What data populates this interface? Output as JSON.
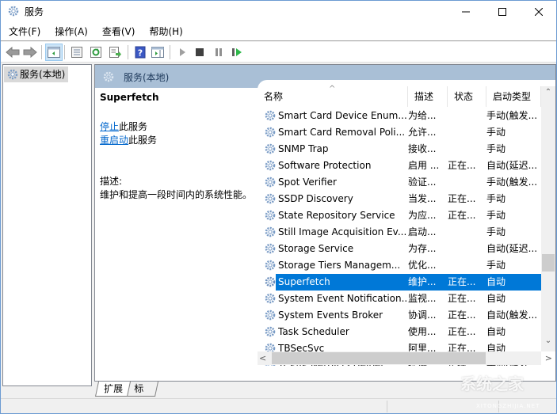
{
  "window": {
    "title": "服务",
    "controls": {
      "minimize": "minimize",
      "maximize": "maximize",
      "close": "close"
    }
  },
  "menu": [
    "文件(F)",
    "操作(A)",
    "查看(V)",
    "帮助(H)"
  ],
  "toolbar": {
    "buttons": [
      "back-icon",
      "forward-icon",
      "show-hide-console-tree-icon",
      "properties-icon",
      "refresh-icon",
      "export-list-icon",
      "help-icon",
      "show-action-pane-icon",
      "start-service-icon",
      "stop-service-icon",
      "pause-service-icon",
      "resume-service-icon"
    ]
  },
  "tree": {
    "selected_label": "服务(本地)"
  },
  "pane": {
    "header": "服务(本地)",
    "detail": {
      "service_name": "Superfetch",
      "stop_link": "停止",
      "stop_suffix": "此服务",
      "restart_link": "重启动",
      "restart_suffix": "此服务",
      "desc_label": "描述:",
      "desc_text": "维护和提高一段时间内的系统性能。"
    }
  },
  "list": {
    "columns": [
      "名称",
      "描述",
      "状态",
      "启动类型"
    ],
    "sorted_column": "名称",
    "rows": [
      {
        "name": "Smart Card Device Enum...",
        "desc": "为给...",
        "status": "",
        "startup": "手动(触发..."
      },
      {
        "name": "Smart Card Removal Poli...",
        "desc": "允许...",
        "status": "",
        "startup": "手动"
      },
      {
        "name": "SNMP Trap",
        "desc": "接收...",
        "status": "",
        "startup": "手动"
      },
      {
        "name": "Software Protection",
        "desc": "启用 ...",
        "status": "正在...",
        "startup": "自动(延迟..."
      },
      {
        "name": "Spot Verifier",
        "desc": "验证...",
        "status": "",
        "startup": "手动(触发..."
      },
      {
        "name": "SSDP Discovery",
        "desc": "当发...",
        "status": "正在...",
        "startup": "手动"
      },
      {
        "name": "State Repository Service",
        "desc": "为应...",
        "status": "正在...",
        "startup": "手动"
      },
      {
        "name": "Still Image Acquisition Ev...",
        "desc": "启动...",
        "status": "",
        "startup": "手动"
      },
      {
        "name": "Storage Service",
        "desc": "为存...",
        "status": "",
        "startup": "自动(延迟..."
      },
      {
        "name": "Storage Tiers Managem...",
        "desc": "优化...",
        "status": "",
        "startup": "手动"
      },
      {
        "name": "Superfetch",
        "desc": "维护...",
        "status": "正在...",
        "startup": "自动",
        "selected": true
      },
      {
        "name": "System Event Notification...",
        "desc": "监视...",
        "status": "正在...",
        "startup": "自动"
      },
      {
        "name": "System Events Broker",
        "desc": "协调...",
        "status": "正在...",
        "startup": "自动(触发..."
      },
      {
        "name": "Task Scheduler",
        "desc": "使用...",
        "status": "正在...",
        "startup": "自动"
      },
      {
        "name": "TBSecSvc",
        "desc": "阿里...",
        "status": "正在...",
        "startup": "自动"
      },
      {
        "name": "TCP/IP NetBIOS Helper",
        "desc": "提供...",
        "status": "正在...",
        "startup": "手动(触发..."
      }
    ]
  },
  "tabs": [
    "扩展",
    "标准"
  ],
  "active_tab": "扩展",
  "watermark": {
    "text": "系统之家",
    "sub": "XITONGZHIJIA.NET"
  },
  "colors": {
    "selection": "#0078d7",
    "pane_header": "#a9bfd6",
    "link": "#0066cc"
  }
}
